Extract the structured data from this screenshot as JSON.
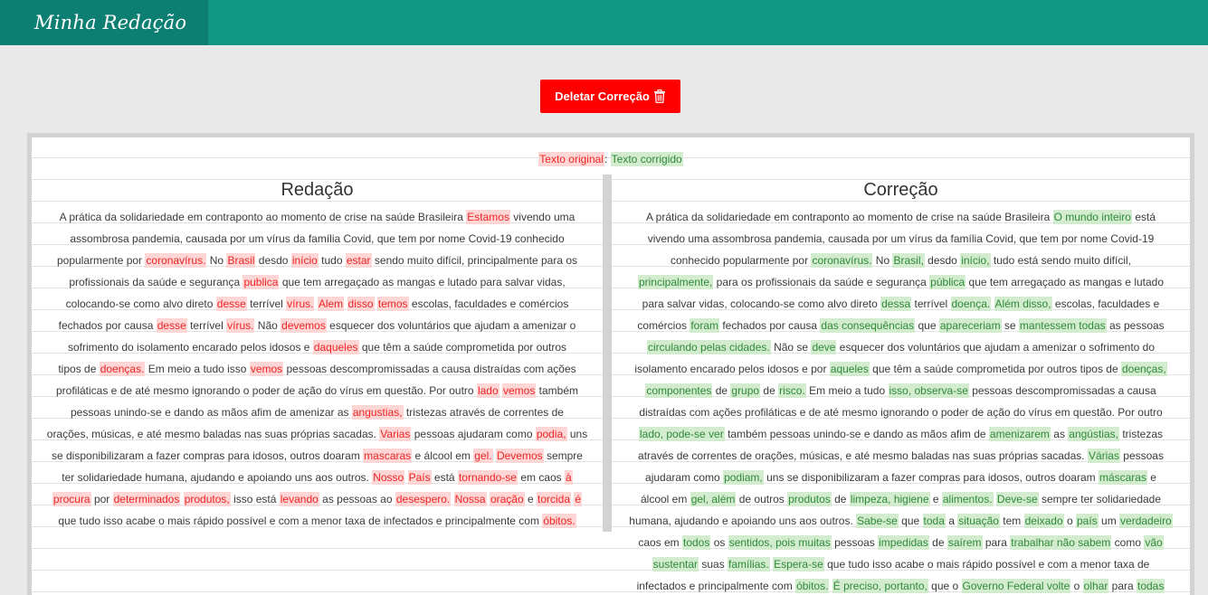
{
  "app": {
    "title": "Minha Redação"
  },
  "toolbar": {
    "delete_label": "Deletar Correção",
    "delete_icon": "trash-icon"
  },
  "legend": {
    "original": "Texto original",
    "separator": ":",
    "corrected": "Texto corrigido"
  },
  "colors": {
    "header": "#119686",
    "brand": "#0d7f72",
    "delete_button": "#ff0000",
    "original_text": "#f22424",
    "original_highlight": "#ffd6d6",
    "corrected_text": "#2f8a37",
    "corrected_highlight": "#d3ecd0"
  },
  "essay": {
    "heading": "Redação",
    "lines": [
      [
        "A prática da solidariedade em contraponto ao momento de crise na saúde Brasileira ",
        {
          "h": "Estamos"
        },
        " vivendo uma"
      ],
      [
        "assombrosa pandemia, causada por um vírus da família Covid, que tem por nome Covid-19 conhecido"
      ],
      [
        "popularmente por ",
        {
          "h": "coronavírus."
        },
        " No ",
        {
          "h": "Brasil"
        },
        " desdo ",
        {
          "h": "início"
        },
        " tudo ",
        {
          "h": "estar"
        },
        " sendo muito difícil, principalmente para os"
      ],
      [
        "profissionais da saúde e segurança ",
        {
          "h": "publica"
        },
        " que tem arregaçado as mangas e lutado para salvar vidas,"
      ],
      [
        "colocando-se como alvo direto ",
        {
          "h": "desse"
        },
        " terrível ",
        {
          "h": "vírus."
        },
        " ",
        {
          "h": "Alem"
        },
        " ",
        {
          "h": "disso"
        },
        " ",
        {
          "h": "temos"
        },
        " escolas, faculdades e comércios"
      ],
      [
        "fechados por causa ",
        {
          "h": "desse"
        },
        " terrível ",
        {
          "h": "vírus."
        },
        " Não ",
        {
          "h": "devemos"
        },
        " esquecer dos voluntários que ajudam a amenizar o"
      ],
      [
        "sofrimento do isolamento encarado pelos idosos e ",
        {
          "h": "daqueles"
        },
        " que têm a saúde comprometida por outros"
      ],
      [
        "tipos de ",
        {
          "h": "doenças."
        },
        " Em meio a tudo isso ",
        {
          "h": "vemos"
        },
        " pessoas descompromissadas a causa distraídas com ações"
      ],
      [
        "profiláticas e de até mesmo ignorando o poder de ação do vírus em questão. Por outro ",
        {
          "h": "lado"
        },
        " ",
        {
          "h": "vemos"
        },
        " também"
      ],
      [
        "pessoas unindo-se e dando as mãos afim de amenizar as ",
        {
          "h": "angustias,"
        },
        " tristezas através de correntes de"
      ],
      [
        "orações, músicas, e até mesmo baladas nas suas próprias sacadas. ",
        {
          "h": "Varias"
        },
        " pessoas ajudaram como ",
        {
          "h": "podia,"
        },
        " uns"
      ],
      [
        "se disponibilizaram a fazer compras para idosos, outros doaram ",
        {
          "h": "mascaras"
        },
        " e álcool em ",
        {
          "h": "gel."
        },
        " ",
        {
          "h": "Devemos"
        },
        " sempre"
      ],
      [
        "ter solidariedade humana, ajudando e apoiando uns aos outros. ",
        {
          "h": "Nosso"
        },
        " ",
        {
          "h": "País"
        },
        " está ",
        {
          "h": "tornando-se"
        },
        " em caos ",
        {
          "h": "à"
        }
      ],
      [
        {
          "h": "procura"
        },
        " por ",
        {
          "h": "determinados"
        },
        " ",
        {
          "h": "produtos,"
        },
        " isso está ",
        {
          "h": "levando"
        },
        " as pessoas ao ",
        {
          "h": "desespero."
        },
        " ",
        {
          "h": "Nossa"
        },
        " ",
        {
          "h": "oração"
        },
        " e ",
        {
          "h": "torcida"
        },
        " ",
        {
          "h": "é"
        }
      ],
      [
        "que tudo isso acabe o mais rápido possível e com a menor taxa de infectados e principalmente com ",
        {
          "h": "óbitos."
        }
      ]
    ]
  },
  "correction": {
    "heading": "Correção",
    "lines": [
      [
        "A prática da solidariedade em contraponto ao momento de crise na saúde Brasileira ",
        {
          "h": "O mundo inteiro"
        },
        " está"
      ],
      [
        "vivendo uma assombrosa pandemia, causada por um vírus da família Covid, que tem por nome Covid-19"
      ],
      [
        "conhecido popularmente por ",
        {
          "h": "coronavírus."
        },
        " No ",
        {
          "h": "Brasil,"
        },
        " desdo ",
        {
          "h": "início,"
        },
        " tudo está sendo muito difícil,"
      ],
      [
        {
          "h": "principalmente,"
        },
        " para os profissionais da saúde e segurança ",
        {
          "h": "pública"
        },
        " que tem arregaçado as mangas e lutado"
      ],
      [
        "para salvar vidas, colocando-se como alvo direto ",
        {
          "h": "dessa"
        },
        " terrível ",
        {
          "h": "doença."
        },
        " ",
        {
          "h": "Além disso,"
        },
        " escolas, faculdades e"
      ],
      [
        "comércios ",
        {
          "h": "foram"
        },
        " fechados por causa ",
        {
          "h": "das consequências"
        },
        " que ",
        {
          "h": "apareceriam"
        },
        " se ",
        {
          "h": "mantessem todas"
        },
        " as pessoas"
      ],
      [
        {
          "h": "circulando pelas cidades."
        },
        " Não se ",
        {
          "h": "deve"
        },
        " esquecer dos voluntários que ajudam a amenizar o sofrimento do"
      ],
      [
        "isolamento encarado pelos idosos e por ",
        {
          "h": "aqueles"
        },
        " que têm a saúde comprometida por outros tipos de ",
        {
          "h": "doenças,"
        }
      ],
      [
        {
          "h": "componentes"
        },
        " de ",
        {
          "h": "grupo"
        },
        " de ",
        {
          "h": "risco."
        },
        " Em meio a tudo ",
        {
          "h": "isso, observa-se"
        },
        " pessoas descompromissadas a causa"
      ],
      [
        "distraídas com ações profiláticas e de até mesmo ignorando o poder de ação do vírus em questão. Por outro"
      ],
      [
        {
          "h": "lado, pode-se ver"
        },
        " também pessoas unindo-se e dando as mãos afim de ",
        {
          "h": "amenizarem"
        },
        " as ",
        {
          "h": "angústias,"
        },
        " tristezas"
      ],
      [
        "através de correntes de orações, músicas, e até mesmo baladas nas suas próprias sacadas. ",
        {
          "h": "Várias"
        },
        " pessoas"
      ],
      [
        "ajudaram como ",
        {
          "h": "podiam,"
        },
        " uns se disponibilizaram a fazer compras para idosos, outros doaram ",
        {
          "h": "máscaras"
        },
        " e"
      ],
      [
        "álcool em ",
        {
          "h": "gel, além"
        },
        " de outros ",
        {
          "h": "produtos"
        },
        " de ",
        {
          "h": "limpeza, higiene"
        },
        " e ",
        {
          "h": "alimentos."
        },
        " ",
        {
          "h": "Deve-se"
        },
        " sempre ter solidariedade"
      ],
      [
        "humana, ajudando e apoiando uns aos outros. ",
        {
          "h": "Sabe-se"
        },
        " que ",
        {
          "h": "toda"
        },
        " a ",
        {
          "h": "situação"
        },
        " tem ",
        {
          "h": "deixado"
        },
        " o ",
        {
          "h": "país"
        },
        " um ",
        {
          "h": "verdadeiro"
        }
      ],
      [
        "caos em ",
        {
          "h": "todos"
        },
        " os ",
        {
          "h": "sentidos, pois muitas"
        },
        " pessoas ",
        {
          "h": "impedidas"
        },
        " de ",
        {
          "h": "saírem"
        },
        " para ",
        {
          "h": "trabalhar não sabem"
        },
        " como ",
        {
          "h": "vão"
        }
      ],
      [
        {
          "h": "sustentar"
        },
        " suas ",
        {
          "h": "famílias."
        },
        " ",
        {
          "h": "Espera-se"
        },
        " que tudo isso acabe o mais rápido possível e com a menor taxa de"
      ],
      [
        "infectados e principalmente com ",
        {
          "h": "óbitos."
        },
        " ",
        {
          "h": "É preciso, portanto,"
        },
        " que o ",
        {
          "h": "Governo Federal volte"
        },
        " o ",
        {
          "h": "olhar"
        },
        " para ",
        {
          "h": "todas"
        }
      ]
    ]
  }
}
